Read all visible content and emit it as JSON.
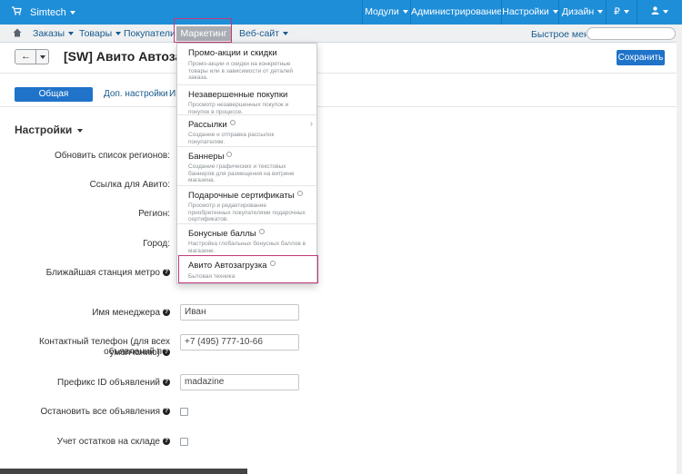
{
  "topbar": {
    "brand": "Simtech",
    "nav": [
      "Модули",
      "Администрирование",
      "Настройки",
      "Дизайн",
      "₽"
    ]
  },
  "secondbar": {
    "orders": "Заказы",
    "products": "Товары",
    "customers": "Покупатели",
    "marketing": "Маркетинг",
    "website": "Веб-сайт",
    "quick_menu": "Быстрое меню"
  },
  "page": {
    "title": "[SW] Авито Автозагрузка",
    "save_label": "Сохранить"
  },
  "tabs": [
    "Общая информация",
    "Доп. настройки",
    "Ин"
  ],
  "section_title": "Настройки",
  "form": {
    "update_regions": "Обновить список регионов:",
    "avito_link": "Ссылка для Авито:",
    "region": "Регион:",
    "city": "Город:",
    "metro": "Ближайшая станция метро",
    "manager_name": "Имя менеджера",
    "manager_value": "Иван",
    "phone_label_1": "Контактный телефон (для всех объявлений по-",
    "phone_label_2": "умолчанию)",
    "phone_value": "+7 (495) 777-10-66",
    "prefix_label": "Префикс ID объявлений",
    "prefix_value": "madazine",
    "stop_all": "Остановить все объявления",
    "stock": "Учет остатков на складе"
  },
  "dropdown": [
    {
      "title": "Промо-акции и скидки",
      "desc": "Промо-акции и скидки на конкретные товары или в зависимости от деталей заказа."
    },
    {
      "title": "Незавершенные покупки",
      "desc": "Просмотр незавершенных покупок и покупок в процессе."
    },
    {
      "title": "Рассылки",
      "desc": "Создание и отправка рассылок покупателям."
    },
    {
      "title": "Баннеры",
      "desc": "Создание графических и текстовых баннеров для размещения на витрине магазина."
    },
    {
      "title": "Подарочные сертификаты",
      "desc": "Просмотр и редактирование приобретенных покупателями подарочных сертификатов."
    },
    {
      "title": "Бонусные баллы",
      "desc": "Настройка глобальных бонусных баллов в магазине."
    },
    {
      "title": "Авито Автозагрузка",
      "desc": "Бытовая техника"
    }
  ]
}
